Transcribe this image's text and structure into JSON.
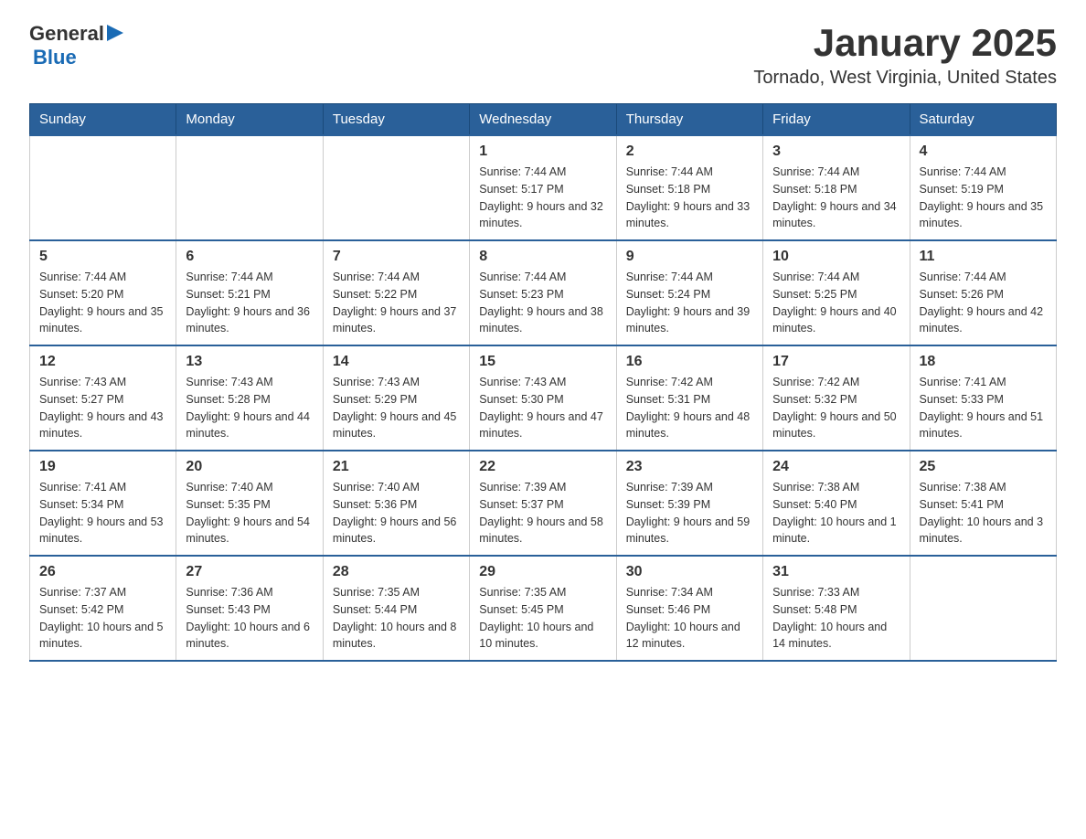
{
  "header": {
    "logo": {
      "general": "General",
      "triangle": "▶",
      "blue": "Blue"
    },
    "title": "January 2025",
    "subtitle": "Tornado, West Virginia, United States"
  },
  "calendar": {
    "days_of_week": [
      "Sunday",
      "Monday",
      "Tuesday",
      "Wednesday",
      "Thursday",
      "Friday",
      "Saturday"
    ],
    "weeks": [
      [
        {
          "day": "",
          "info": ""
        },
        {
          "day": "",
          "info": ""
        },
        {
          "day": "",
          "info": ""
        },
        {
          "day": "1",
          "info": "Sunrise: 7:44 AM\nSunset: 5:17 PM\nDaylight: 9 hours and 32 minutes."
        },
        {
          "day": "2",
          "info": "Sunrise: 7:44 AM\nSunset: 5:18 PM\nDaylight: 9 hours and 33 minutes."
        },
        {
          "day": "3",
          "info": "Sunrise: 7:44 AM\nSunset: 5:18 PM\nDaylight: 9 hours and 34 minutes."
        },
        {
          "day": "4",
          "info": "Sunrise: 7:44 AM\nSunset: 5:19 PM\nDaylight: 9 hours and 35 minutes."
        }
      ],
      [
        {
          "day": "5",
          "info": "Sunrise: 7:44 AM\nSunset: 5:20 PM\nDaylight: 9 hours and 35 minutes."
        },
        {
          "day": "6",
          "info": "Sunrise: 7:44 AM\nSunset: 5:21 PM\nDaylight: 9 hours and 36 minutes."
        },
        {
          "day": "7",
          "info": "Sunrise: 7:44 AM\nSunset: 5:22 PM\nDaylight: 9 hours and 37 minutes."
        },
        {
          "day": "8",
          "info": "Sunrise: 7:44 AM\nSunset: 5:23 PM\nDaylight: 9 hours and 38 minutes."
        },
        {
          "day": "9",
          "info": "Sunrise: 7:44 AM\nSunset: 5:24 PM\nDaylight: 9 hours and 39 minutes."
        },
        {
          "day": "10",
          "info": "Sunrise: 7:44 AM\nSunset: 5:25 PM\nDaylight: 9 hours and 40 minutes."
        },
        {
          "day": "11",
          "info": "Sunrise: 7:44 AM\nSunset: 5:26 PM\nDaylight: 9 hours and 42 minutes."
        }
      ],
      [
        {
          "day": "12",
          "info": "Sunrise: 7:43 AM\nSunset: 5:27 PM\nDaylight: 9 hours and 43 minutes."
        },
        {
          "day": "13",
          "info": "Sunrise: 7:43 AM\nSunset: 5:28 PM\nDaylight: 9 hours and 44 minutes."
        },
        {
          "day": "14",
          "info": "Sunrise: 7:43 AM\nSunset: 5:29 PM\nDaylight: 9 hours and 45 minutes."
        },
        {
          "day": "15",
          "info": "Sunrise: 7:43 AM\nSunset: 5:30 PM\nDaylight: 9 hours and 47 minutes."
        },
        {
          "day": "16",
          "info": "Sunrise: 7:42 AM\nSunset: 5:31 PM\nDaylight: 9 hours and 48 minutes."
        },
        {
          "day": "17",
          "info": "Sunrise: 7:42 AM\nSunset: 5:32 PM\nDaylight: 9 hours and 50 minutes."
        },
        {
          "day": "18",
          "info": "Sunrise: 7:41 AM\nSunset: 5:33 PM\nDaylight: 9 hours and 51 minutes."
        }
      ],
      [
        {
          "day": "19",
          "info": "Sunrise: 7:41 AM\nSunset: 5:34 PM\nDaylight: 9 hours and 53 minutes."
        },
        {
          "day": "20",
          "info": "Sunrise: 7:40 AM\nSunset: 5:35 PM\nDaylight: 9 hours and 54 minutes."
        },
        {
          "day": "21",
          "info": "Sunrise: 7:40 AM\nSunset: 5:36 PM\nDaylight: 9 hours and 56 minutes."
        },
        {
          "day": "22",
          "info": "Sunrise: 7:39 AM\nSunset: 5:37 PM\nDaylight: 9 hours and 58 minutes."
        },
        {
          "day": "23",
          "info": "Sunrise: 7:39 AM\nSunset: 5:39 PM\nDaylight: 9 hours and 59 minutes."
        },
        {
          "day": "24",
          "info": "Sunrise: 7:38 AM\nSunset: 5:40 PM\nDaylight: 10 hours and 1 minute."
        },
        {
          "day": "25",
          "info": "Sunrise: 7:38 AM\nSunset: 5:41 PM\nDaylight: 10 hours and 3 minutes."
        }
      ],
      [
        {
          "day": "26",
          "info": "Sunrise: 7:37 AM\nSunset: 5:42 PM\nDaylight: 10 hours and 5 minutes."
        },
        {
          "day": "27",
          "info": "Sunrise: 7:36 AM\nSunset: 5:43 PM\nDaylight: 10 hours and 6 minutes."
        },
        {
          "day": "28",
          "info": "Sunrise: 7:35 AM\nSunset: 5:44 PM\nDaylight: 10 hours and 8 minutes."
        },
        {
          "day": "29",
          "info": "Sunrise: 7:35 AM\nSunset: 5:45 PM\nDaylight: 10 hours and 10 minutes."
        },
        {
          "day": "30",
          "info": "Sunrise: 7:34 AM\nSunset: 5:46 PM\nDaylight: 10 hours and 12 minutes."
        },
        {
          "day": "31",
          "info": "Sunrise: 7:33 AM\nSunset: 5:48 PM\nDaylight: 10 hours and 14 minutes."
        },
        {
          "day": "",
          "info": ""
        }
      ]
    ]
  }
}
